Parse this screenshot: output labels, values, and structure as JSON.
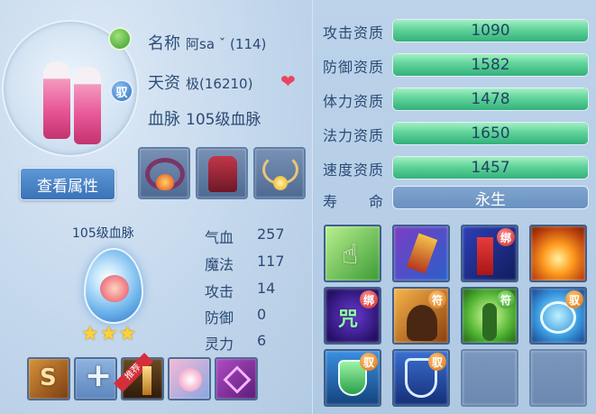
{
  "pet": {
    "name_label": "名称",
    "name_value": "阿sa ˇ (114)",
    "aptitude_label": "天资",
    "aptitude_value": "极(16210)",
    "bloodline_label": "血脉",
    "bloodline_value": "105级血脉",
    "name_badge": "",
    "tame_badge": "驭",
    "view_attr_button": "查看属性"
  },
  "bloodline_panel": {
    "title": "105级血脉",
    "stars": "★★★"
  },
  "stats": [
    {
      "label": "气血",
      "value": "257"
    },
    {
      "label": "魔法",
      "value": "117"
    },
    {
      "label": "攻击",
      "value": "14"
    },
    {
      "label": "防御",
      "value": "0"
    },
    {
      "label": "灵力",
      "value": "6"
    }
  ],
  "slots": {
    "recommend_tag": "推荐"
  },
  "resists": [
    {
      "label": "攻击资质",
      "value": "1090",
      "fill": 1.0
    },
    {
      "label": "防御资质",
      "value": "1582",
      "fill": 1.0
    },
    {
      "label": "体力资质",
      "value": "1478",
      "fill": 1.0
    },
    {
      "label": "法力资质",
      "value": "1650",
      "fill": 1.0
    },
    {
      "label": "速度资质",
      "value": "1457",
      "fill": 1.0
    }
  ],
  "lifespan": {
    "label": "寿　　命",
    "value": "永生"
  },
  "skills": [
    {
      "tag": ""
    },
    {
      "tag": ""
    },
    {
      "tag": "绑"
    },
    {
      "tag": ""
    },
    {
      "tag": "绑",
      "glyph": "咒"
    },
    {
      "tag": "符"
    },
    {
      "tag": "符"
    },
    {
      "tag": "驭"
    },
    {
      "tag": "驭"
    },
    {
      "tag": "驭"
    }
  ],
  "colors": {
    "bar_fill": "#5fd39a",
    "bar_track": "#2f5880",
    "heart": "#e8455e"
  }
}
